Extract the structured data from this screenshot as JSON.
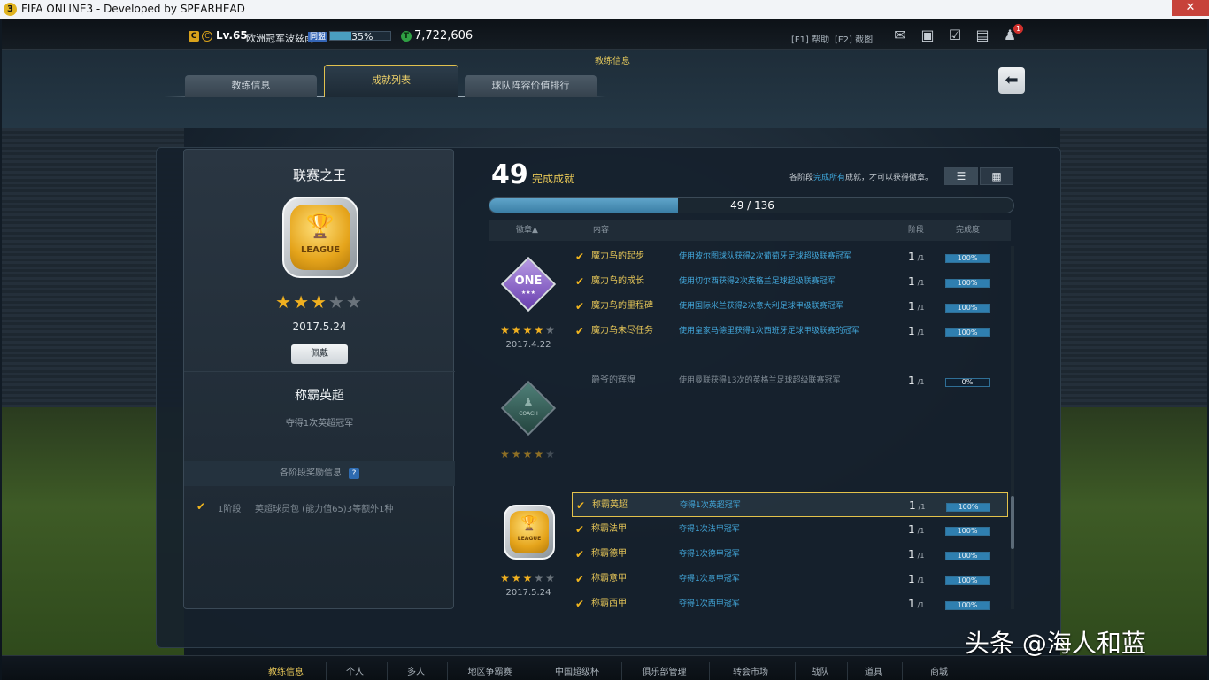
{
  "window": {
    "logo": "3",
    "title": "FIFA ONLINE3 - Developed by SPEARHEAD"
  },
  "topbar": {
    "badge": "C",
    "ring": "C",
    "level": "Lv.65",
    "team": "欧洲冠军波兹南",
    "tag": "同盟",
    "xp_percent": 35,
    "xp_label": "35%",
    "currency_icon": "T",
    "money": "7,722,606",
    "help": "[F1] 帮助",
    "screenshot": "[F2] 截图",
    "notification_count": "1",
    "icons": [
      "mail-icon",
      "panel-icon",
      "calendar-check-icon",
      "chat-icon",
      "user-alert-icon"
    ]
  },
  "header": {
    "section_title": "教练信息",
    "tabs": [
      {
        "label": "教练信息",
        "active": false
      },
      {
        "label": "成就列表",
        "active": true
      },
      {
        "label": "球队阵容价值排行",
        "active": false
      }
    ],
    "back_icon": "⬅"
  },
  "detail": {
    "title": "联赛之王",
    "medal_label": "LEAGUE",
    "stars_on": 3,
    "stars_total": 5,
    "date": "2017.5.24",
    "equip_button": "佩戴",
    "sub_title": "称霸英超",
    "sub_desc": "夺得1次英超冠军",
    "reward_header": "各阶段奖励信息",
    "reward_help": "?",
    "rewards": [
      {
        "stage": "1阶段",
        "text": "英超球员包 (能力值65)3等额外1种"
      }
    ]
  },
  "summary": {
    "count": "49",
    "count_label": "完成成就",
    "hint_pre": "各阶段",
    "hint_highlight": "完成所有",
    "hint_post": "成就，才可以获得徽章。",
    "list_view_icon": "☰",
    "grid_view_icon": "▦",
    "progress_value": 49,
    "progress_total": 136,
    "progress_text": "49 / 136"
  },
  "columns": {
    "badge": "徽章▲",
    "content": "内容",
    "stage": "阶段",
    "completion": "完成度"
  },
  "groups": [
    {
      "medal": "ONE",
      "medal_sub": "★★★",
      "stars_on": 4,
      "date": "2017.4.22",
      "rows": [
        {
          "name": "魔力鸟的起步",
          "desc": "使用波尔图球队获得2次葡萄牙足球超级联赛冠军",
          "stage": "1",
          "stage_total": "/1",
          "percent": 100,
          "label": "100%"
        },
        {
          "name": "魔力鸟的成长",
          "desc": "使用切尔西获得2次英格兰足球超级联赛冠军",
          "stage": "1",
          "stage_total": "/1",
          "percent": 100,
          "label": "100%"
        },
        {
          "name": "魔力鸟的里程碑",
          "desc": "使用国际米兰获得2次意大利足球甲级联赛冠军",
          "stage": "1",
          "stage_total": "/1",
          "percent": 100,
          "label": "100%"
        },
        {
          "name": "魔力鸟未尽任务",
          "desc": "使用皇家马德里获得1次西班牙足球甲级联赛的冠军",
          "stage": "1",
          "stage_total": "/1",
          "percent": 100,
          "label": "100%"
        }
      ]
    },
    {
      "medal": "COACH",
      "stars_on": 4,
      "date": "",
      "rows": [
        {
          "name": "爵爷的辉煌",
          "desc": "使用曼联获得13次的英格兰足球超级联赛冠军",
          "stage": "1",
          "stage_total": "/1",
          "percent": 0,
          "label": "0%"
        }
      ]
    },
    {
      "medal": "LEAGUE",
      "stars_on": 3,
      "date": "2017.5.24",
      "rows": [
        {
          "name": "称霸英超",
          "desc": "夺得1次英超冠军",
          "stage": "1",
          "stage_total": "/1",
          "percent": 100,
          "label": "100%"
        },
        {
          "name": "称霸法甲",
          "desc": "夺得1次法甲冠军",
          "stage": "1",
          "stage_total": "/1",
          "percent": 100,
          "label": "100%"
        },
        {
          "name": "称霸德甲",
          "desc": "夺得1次德甲冠军",
          "stage": "1",
          "stage_total": "/1",
          "percent": 100,
          "label": "100%"
        },
        {
          "name": "称霸意甲",
          "desc": "夺得1次意甲冠军",
          "stage": "1",
          "stage_total": "/1",
          "percent": 100,
          "label": "100%"
        },
        {
          "name": "称霸西甲",
          "desc": "夺得1次西甲冠军",
          "stage": "1",
          "stage_total": "/1",
          "percent": 100,
          "label": "100%"
        }
      ]
    }
  ],
  "bottom_nav": [
    "教练信息",
    "个人",
    "多人",
    "地区争霸赛",
    "中国超级杯",
    "俱乐部管理",
    "转会市场",
    "战队",
    "道具",
    "商城"
  ],
  "watermark": "头条 @海人和蓝",
  "colors": {
    "gold": "#e6c658",
    "link_blue": "#42a6d9",
    "progress": "#3b7fa6",
    "star": "#f0b020"
  }
}
